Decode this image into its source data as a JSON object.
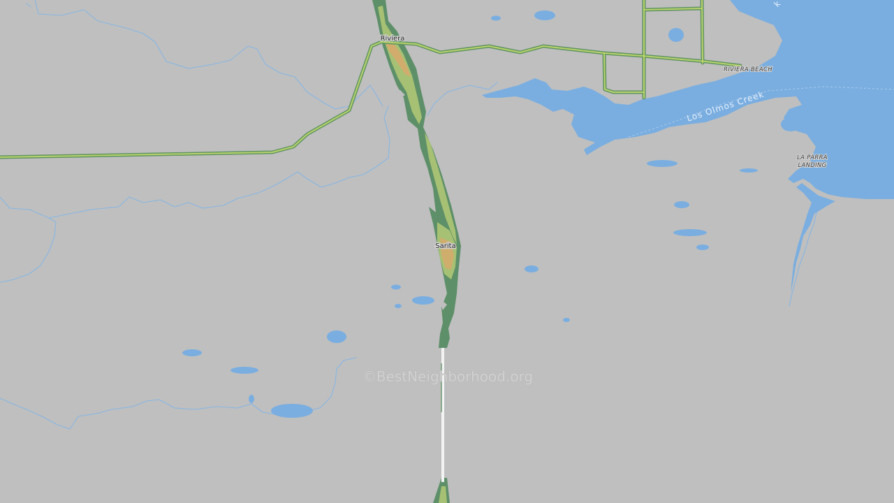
{
  "map": {
    "places": {
      "riviera": "Riviera",
      "sarita": "Sarita"
    },
    "areas": {
      "riviera_beach": "RIVIERA BEACH",
      "la_parra_landing_line1": "LA PARRA",
      "la_parra_landing_line2": "LANDING"
    },
    "waterways": {
      "los_olmos_creek": "Los Olmos Creek",
      "partial_creek_label": "k"
    },
    "watermark": "©BestNeighborhood.org",
    "colors": {
      "background": "#bfbfbf",
      "water": "#7aaee0",
      "stream": "#87b6e3",
      "highway_outer": "#5f9363",
      "highway_inner": "#b9d36a",
      "corridor_dark": "#5d8f68",
      "corridor_light": "#a7c174",
      "hotspot": "#d9a86c",
      "road_gap": "#f3f3f3"
    }
  }
}
